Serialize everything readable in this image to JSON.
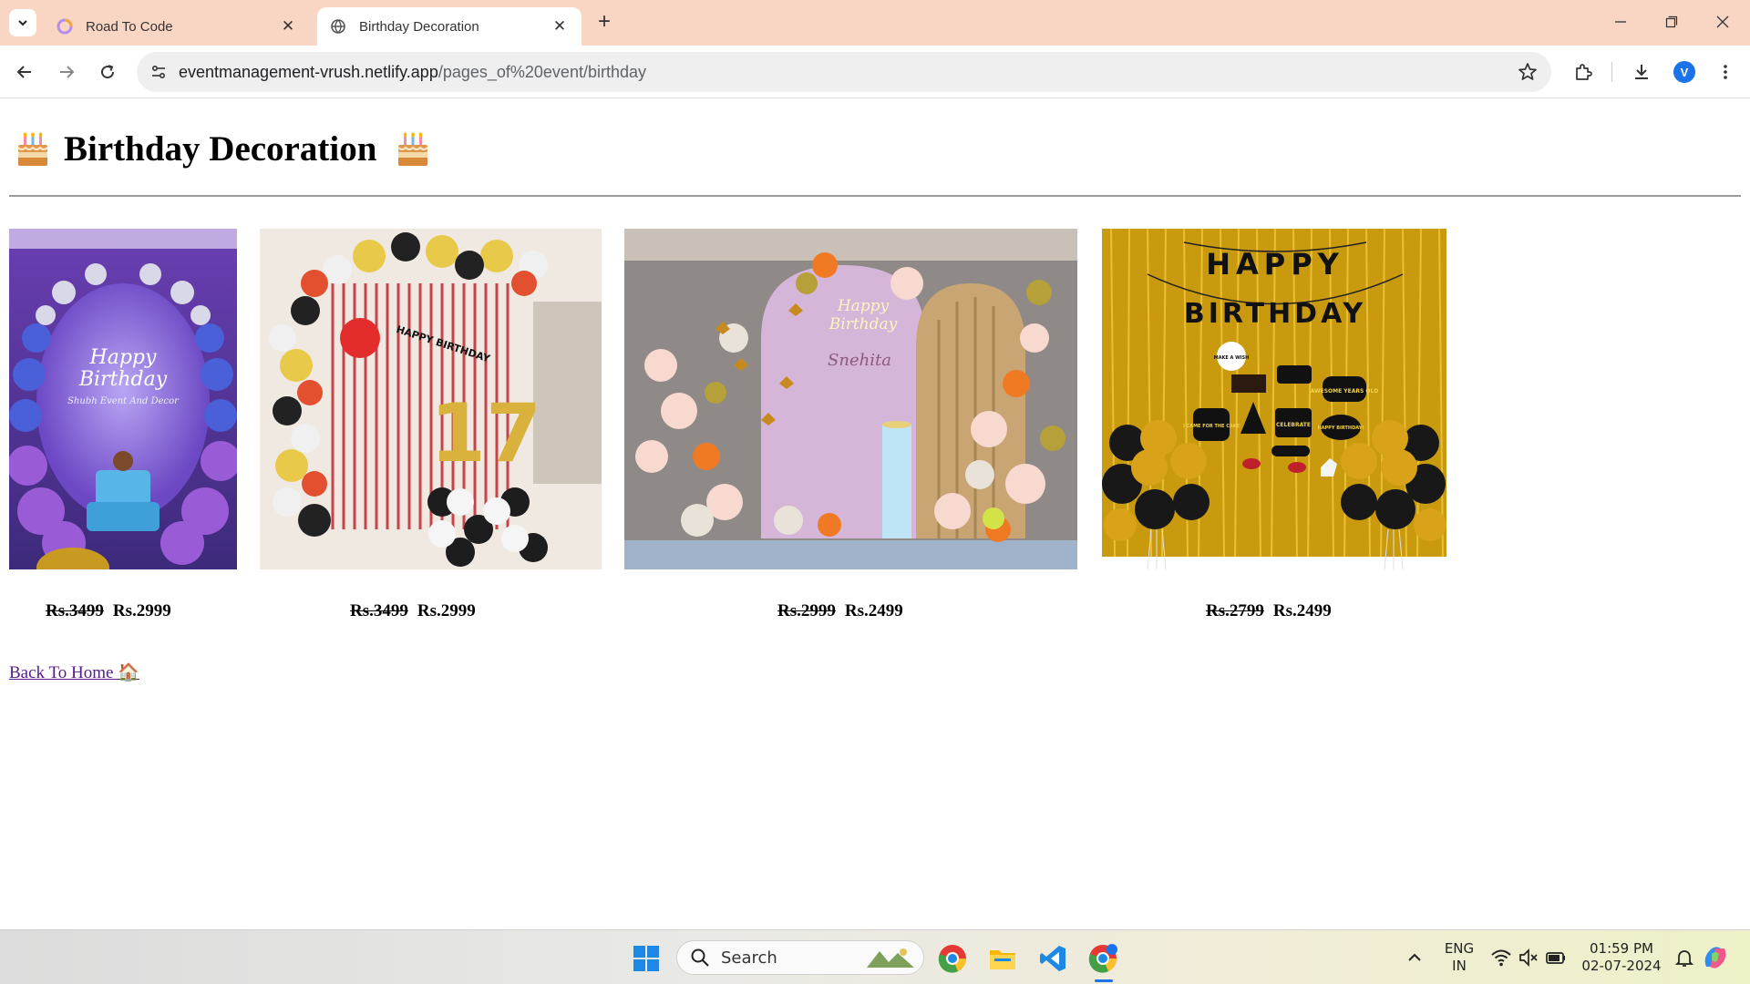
{
  "browser": {
    "tabs": [
      {
        "title": "Road To Code",
        "favicon": "road-to-code-icon",
        "active": false
      },
      {
        "title": "Birthday Decoration",
        "favicon": "globe-icon",
        "active": true
      }
    ],
    "url_domain": "eventmanagement-vrush.netlify.app",
    "url_path": "/pages_of%20event/birthday",
    "profile_initial": "V"
  },
  "page": {
    "heading": "Birthday Decoration",
    "heading_icon": "birthday-cake-icon",
    "products": [
      {
        "image": "balloon-arch-purple-blue-with-cake",
        "old_price": "Rs.3499",
        "price": "Rs.2999"
      },
      {
        "image": "balloon-arch-red-curtain-number-17",
        "old_price": "Rs.3499",
        "price": "Rs.2999"
      },
      {
        "image": "pastel-backdrop-butterflies-balloons",
        "old_price": "Rs.2999",
        "price": "Rs.2499"
      },
      {
        "image": "gold-black-happy-birthday-banner",
        "old_price": "Rs.2799",
        "price": "Rs.2499"
      }
    ],
    "image_texts": {
      "img1_line1": "Happy",
      "img1_line2": "Birthday",
      "img1_line3": "Shubh Event And Decor",
      "img2_banner": "HAPPY BIRTHDAY",
      "img2_number": "17",
      "img3_neon_line1": "Happy",
      "img3_neon_line2": "Birthday",
      "img3_name": "Snehita",
      "img4_banner_top": "HAPPY",
      "img4_banner_bottom": "BIRTHDAY",
      "img4_prop1": "MAKE A WISH",
      "img4_prop2": "AWESOME YEARS OLD",
      "img4_prop3": "I CAME FOR THE CAKE",
      "img4_prop4": "CELEBRATE",
      "img4_prop5": "HAPPY BIRTHDAY!"
    },
    "back_link": "Back To Home 🏠"
  },
  "taskbar": {
    "search_placeholder": "Search",
    "lang_line1": "ENG",
    "lang_line2": "IN",
    "time": "01:59 PM",
    "date": "02-07-2024"
  },
  "colors": {
    "tabbar": "#f9d6c3",
    "link_visited": "#551a8b",
    "divider": "#9a9a9a"
  }
}
